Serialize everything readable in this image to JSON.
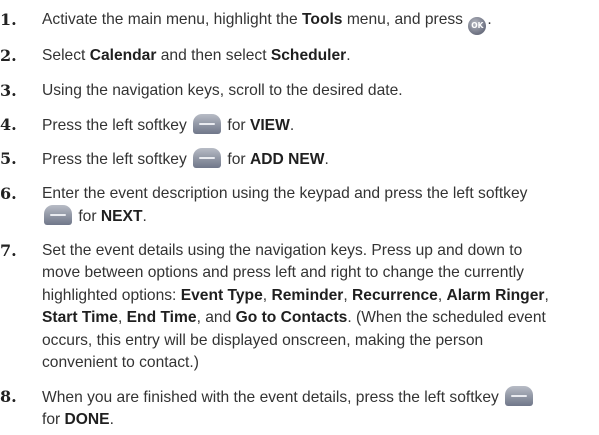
{
  "steps": [
    {
      "number": "1.",
      "parts": [
        {
          "t": "Activate the main menu, highlight the "
        },
        {
          "t": "Tools",
          "b": true
        },
        {
          "t": " menu, and press "
        },
        {
          "icon": "ok-button-icon",
          "label": "OK"
        },
        {
          "t": "."
        }
      ]
    },
    {
      "number": "2.",
      "parts": [
        {
          "t": "Select "
        },
        {
          "t": "Calendar",
          "b": true
        },
        {
          "t": " and then select "
        },
        {
          "t": "Scheduler",
          "b": true
        },
        {
          "t": "."
        }
      ]
    },
    {
      "number": "3.",
      "parts": [
        {
          "t": "Using the navigation keys, scroll to the desired date."
        }
      ]
    },
    {
      "number": "4.",
      "parts": [
        {
          "t": "Press the left softkey "
        },
        {
          "icon": "left-softkey-icon"
        },
        {
          "t": " for "
        },
        {
          "t": "VIEW",
          "b": true
        },
        {
          "t": "."
        }
      ]
    },
    {
      "number": "5.",
      "parts": [
        {
          "t": "Press the left softkey "
        },
        {
          "icon": "left-softkey-icon"
        },
        {
          "t": " for "
        },
        {
          "t": "ADD NEW",
          "b": true
        },
        {
          "t": "."
        }
      ]
    },
    {
      "number": "6.",
      "parts": [
        {
          "t": "Enter the event description using the keypad and press the left softkey"
        },
        {
          "br": true
        },
        {
          "icon": "left-softkey-icon"
        },
        {
          "t": " for "
        },
        {
          "t": "NEXT",
          "b": true
        },
        {
          "t": "."
        }
      ]
    },
    {
      "number": "7.",
      "parts": [
        {
          "t": "Set the event details using the navigation keys. Press up and down to"
        },
        {
          "br": true
        },
        {
          "t": "move between options and press left and right to change the currently"
        },
        {
          "br": true
        },
        {
          "t": "highlighted options: "
        },
        {
          "t": "Event Type",
          "b": true
        },
        {
          "t": ", "
        },
        {
          "t": "Reminder",
          "b": true
        },
        {
          "t": ", "
        },
        {
          "t": "Recurrence",
          "b": true
        },
        {
          "t": ", "
        },
        {
          "t": "Alarm Ringer",
          "b": true
        },
        {
          "t": ","
        },
        {
          "br": true
        },
        {
          "t": "Start Time",
          "b": true
        },
        {
          "t": ", "
        },
        {
          "t": "End Time",
          "b": true
        },
        {
          "t": ", and "
        },
        {
          "t": "Go to Contacts",
          "b": true
        },
        {
          "t": ". (When the scheduled event"
        },
        {
          "br": true
        },
        {
          "t": "occurs, this entry will be displayed onscreen, making the person"
        },
        {
          "br": true
        },
        {
          "t": "convenient to contact.)"
        }
      ]
    },
    {
      "number": "8.",
      "parts": [
        {
          "t": "When you are finished with the event details, press the left softkey "
        },
        {
          "icon": "left-softkey-icon"
        },
        {
          "br": true
        },
        {
          "t": "for "
        },
        {
          "t": "DONE",
          "b": true
        },
        {
          "t": "."
        }
      ]
    }
  ]
}
